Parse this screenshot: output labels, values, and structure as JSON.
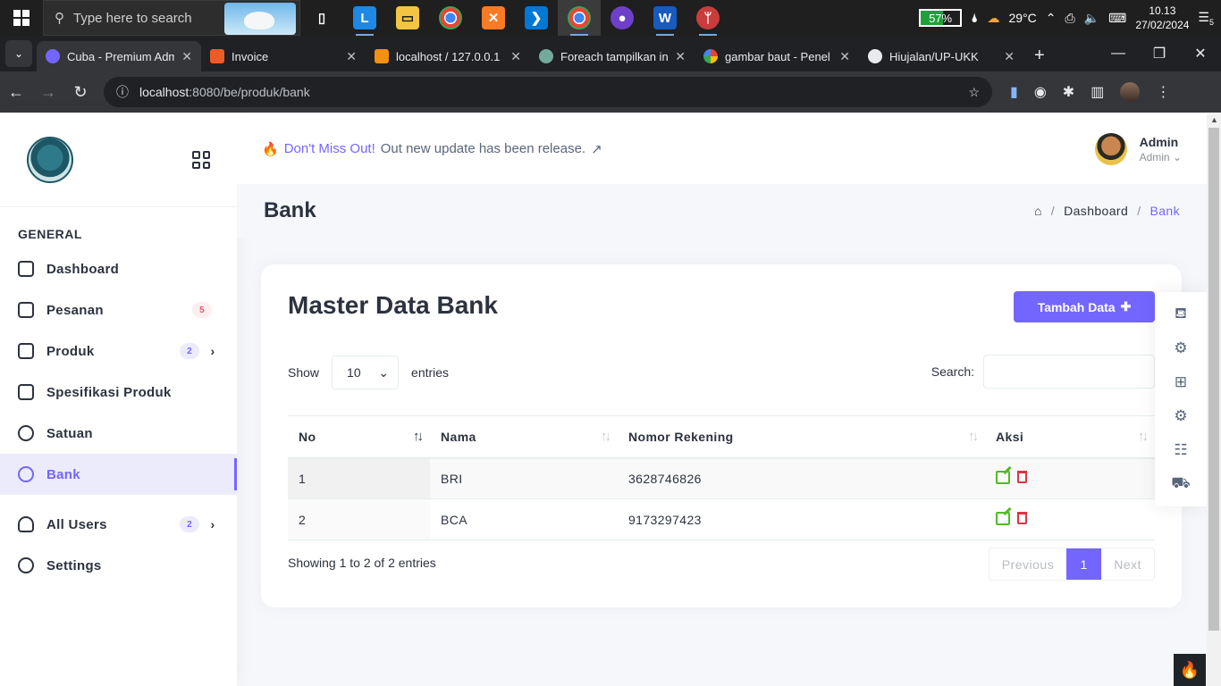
{
  "taskbar": {
    "search_placeholder": "Type here to search",
    "battery": "57%",
    "weather": "29°C",
    "time": "10.13",
    "date": "27/02/2024",
    "notif_count": "5"
  },
  "tabs": [
    {
      "title": "Cuba - Premium Adm",
      "active": true
    },
    {
      "title": "Invoice"
    },
    {
      "title": "localhost / 127.0.0.1 /"
    },
    {
      "title": "Foreach tampilkan in"
    },
    {
      "title": "gambar baut - Penel"
    },
    {
      "title": "Hiujalan/UP-UKK"
    }
  ],
  "address": {
    "host": "localhost",
    "path": ":8080/be/produk/bank"
  },
  "sidebar": {
    "section": "GENERAL",
    "items": [
      {
        "label": "Dashboard",
        "icon": "home-icon"
      },
      {
        "label": "Pesanan",
        "icon": "basket-icon",
        "badge": "5"
      },
      {
        "label": "Produk",
        "icon": "layers-icon",
        "badge": "2"
      },
      {
        "label": "Spesifikasi Produk",
        "icon": "clipboard-icon"
      },
      {
        "label": "Satuan",
        "icon": "share-icon"
      },
      {
        "label": "Bank",
        "icon": "globe-icon",
        "active": true
      },
      {
        "label": "All Users",
        "icon": "users-icon",
        "badge": "2"
      },
      {
        "label": "Settings",
        "icon": "info-icon"
      }
    ]
  },
  "header": {
    "notice_highlight": "Don't Miss Out!",
    "notice_text": " Out new update has been release.",
    "notice_arrow": "↗",
    "user_name": "Admin",
    "user_role": "Admin"
  },
  "page": {
    "title": "Bank",
    "breadcrumb_dashboard": "Dashboard",
    "breadcrumb_current": "Bank"
  },
  "card": {
    "title": "Master Data Bank",
    "add_button": "Tambah Data",
    "show_label": "Show",
    "entries_label": "entries",
    "page_length": "10",
    "search_label": "Search:",
    "columns": [
      "No",
      "Nama",
      "Nomor Rekening",
      "Aksi"
    ],
    "rows": [
      {
        "no": "1",
        "nama": "BRI",
        "rekening": "3628746826"
      },
      {
        "no": "2",
        "nama": "BCA",
        "rekening": "9173297423"
      }
    ],
    "info": "Showing 1 to 2 of 2 entries",
    "prev": "Previous",
    "page": "1",
    "next": "Next"
  },
  "colors": {
    "accent": "#7366ff",
    "edit": "#51bb25",
    "delete": "#dc3545"
  }
}
